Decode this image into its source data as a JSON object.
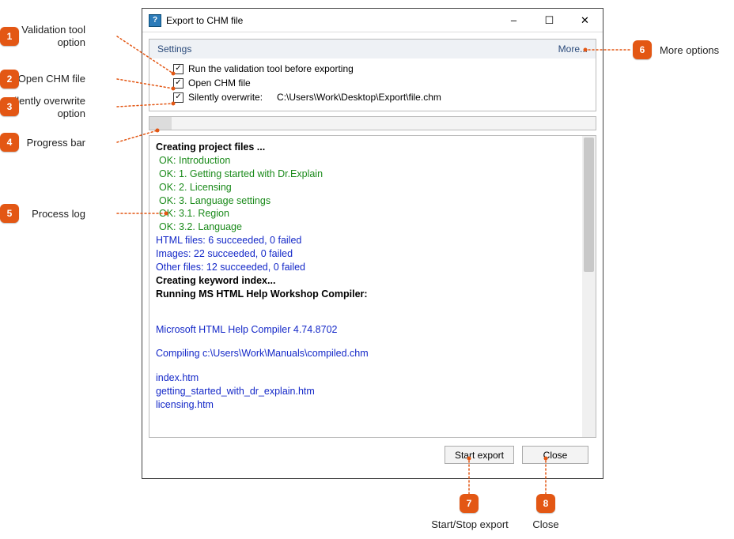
{
  "window": {
    "title": "Export to CHM file",
    "icon_glyph": "?"
  },
  "settings": {
    "header": "Settings",
    "more": "More...",
    "run_validation": "Run the validation tool before exporting",
    "open_chm": "Open CHM file",
    "silent_label": "Silently overwrite:",
    "silent_path": "C:\\Users\\Work\\Desktop\\Export\\file.chm"
  },
  "log": {
    "lines": [
      {
        "text": "Creating project files ...",
        "cls": "log-bold"
      },
      {
        "text": "OK: Introduction",
        "cls": "log-ok"
      },
      {
        "text": "OK: 1. Getting started with Dr.Explain",
        "cls": "log-ok"
      },
      {
        "text": "OK: 2. Licensing",
        "cls": "log-ok"
      },
      {
        "text": "OK: 3. Language settings",
        "cls": "log-ok"
      },
      {
        "text": "OK: 3.1. Region",
        "cls": "log-ok"
      },
      {
        "text": "OK: 3.2. Language",
        "cls": "log-ok"
      },
      {
        "text": "HTML files:  6 succeeded, 0 failed",
        "cls": "log-file"
      },
      {
        "text": "Images:  22 succeeded, 0 failed",
        "cls": "log-file"
      },
      {
        "text": "Other files:  12 succeeded, 0 failed",
        "cls": "log-file"
      },
      {
        "text": "Creating keyword index...",
        "cls": "log-bold"
      },
      {
        "text": "Running MS HTML Help Workshop Compiler:",
        "cls": "log-bold"
      },
      {
        "text": "",
        "cls": "log-blank"
      },
      {
        "text": "",
        "cls": "log-blank"
      },
      {
        "text": "Microsoft HTML Help Compiler 4.74.8702",
        "cls": "log-file"
      },
      {
        "text": "",
        "cls": "log-blank"
      },
      {
        "text": "Compiling c:\\Users\\Work\\Manuals\\compiled.chm",
        "cls": "log-file"
      },
      {
        "text": "",
        "cls": "log-blank"
      },
      {
        "text": "index.htm",
        "cls": "log-file"
      },
      {
        "text": "getting_started_with_dr_explain.htm",
        "cls": "log-file"
      },
      {
        "text": "licensing.htm",
        "cls": "log-file"
      }
    ]
  },
  "buttons": {
    "start": "Start export",
    "close": "Close"
  },
  "callouts": {
    "c1": "Validation tool option",
    "c2": "Open CHM file",
    "c3": "Silently overwrite option",
    "c4": "Progress bar",
    "c5": "Process log",
    "c6": "More options",
    "c7": "Start/Stop export",
    "c8": "Close"
  }
}
